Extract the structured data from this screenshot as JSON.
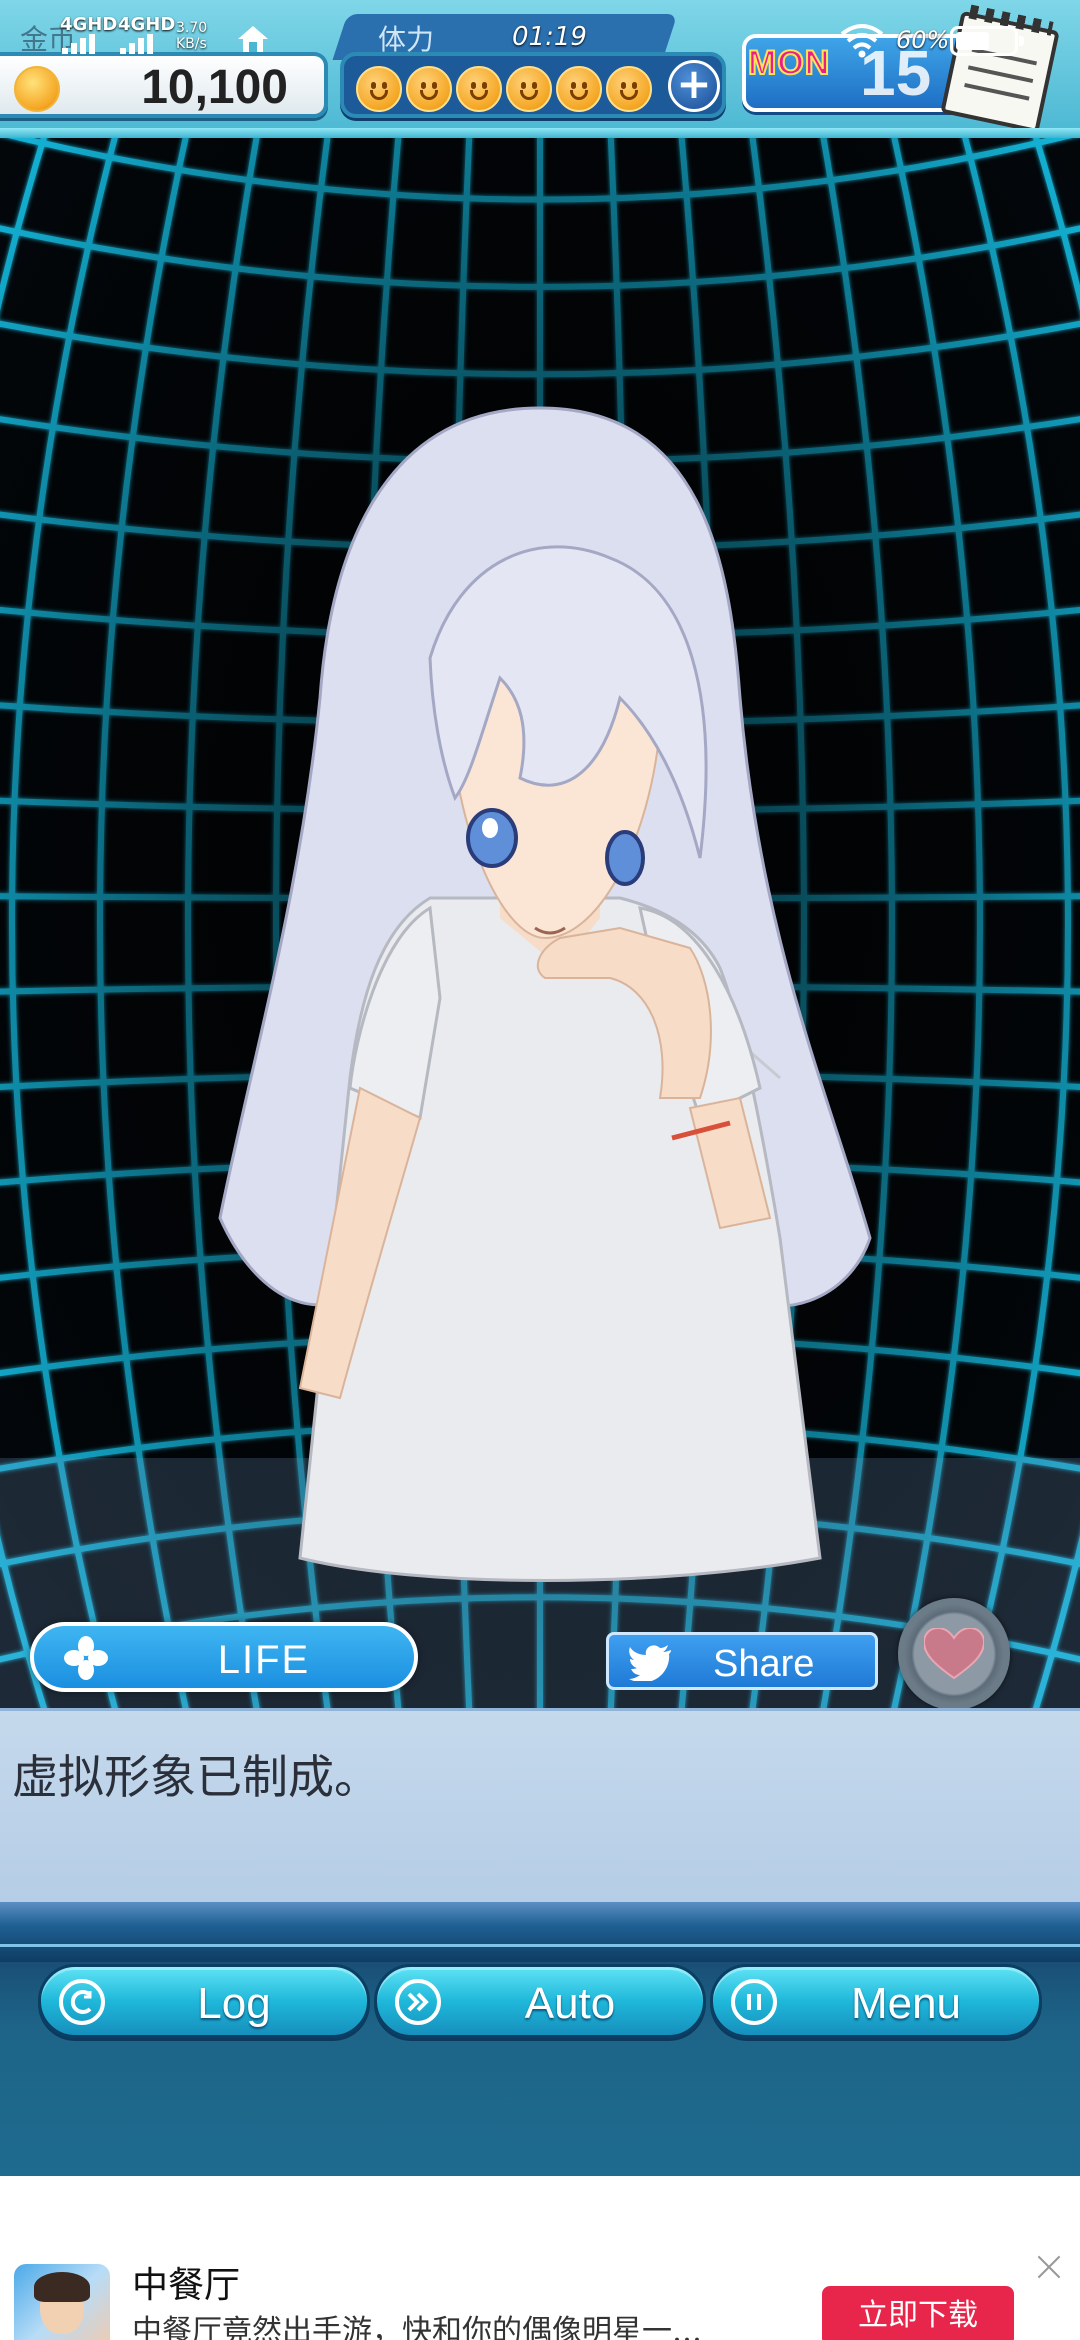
{
  "status_bar": {
    "signal_1": "4GHD",
    "signal_2": "4GHD",
    "net_speed_value": "3.70",
    "net_speed_unit": "KB/s",
    "time": "01:19",
    "battery": "60%"
  },
  "hud": {
    "gold_label": "金币",
    "gold_value": "10,100",
    "stamina_label": "体力",
    "stamina_count": 6,
    "day_label": "MON",
    "day_number": "15"
  },
  "actions": {
    "life_label": "LIFE",
    "share_label": "Share"
  },
  "dialogue": {
    "text": "虚拟形象已制成。"
  },
  "menu": {
    "log_label": "Log",
    "auto_label": "Auto",
    "menu_label": "Menu"
  },
  "ad": {
    "title": "中餐厅",
    "description": "中餐厅竟然出手游，快和你的偶像明星一…",
    "cta": "立即下载"
  },
  "colors": {
    "grid": "#19c8f0",
    "life_button": "#1b8fe0",
    "menu_button": "#1fb8da",
    "cta": "#e8264b"
  }
}
